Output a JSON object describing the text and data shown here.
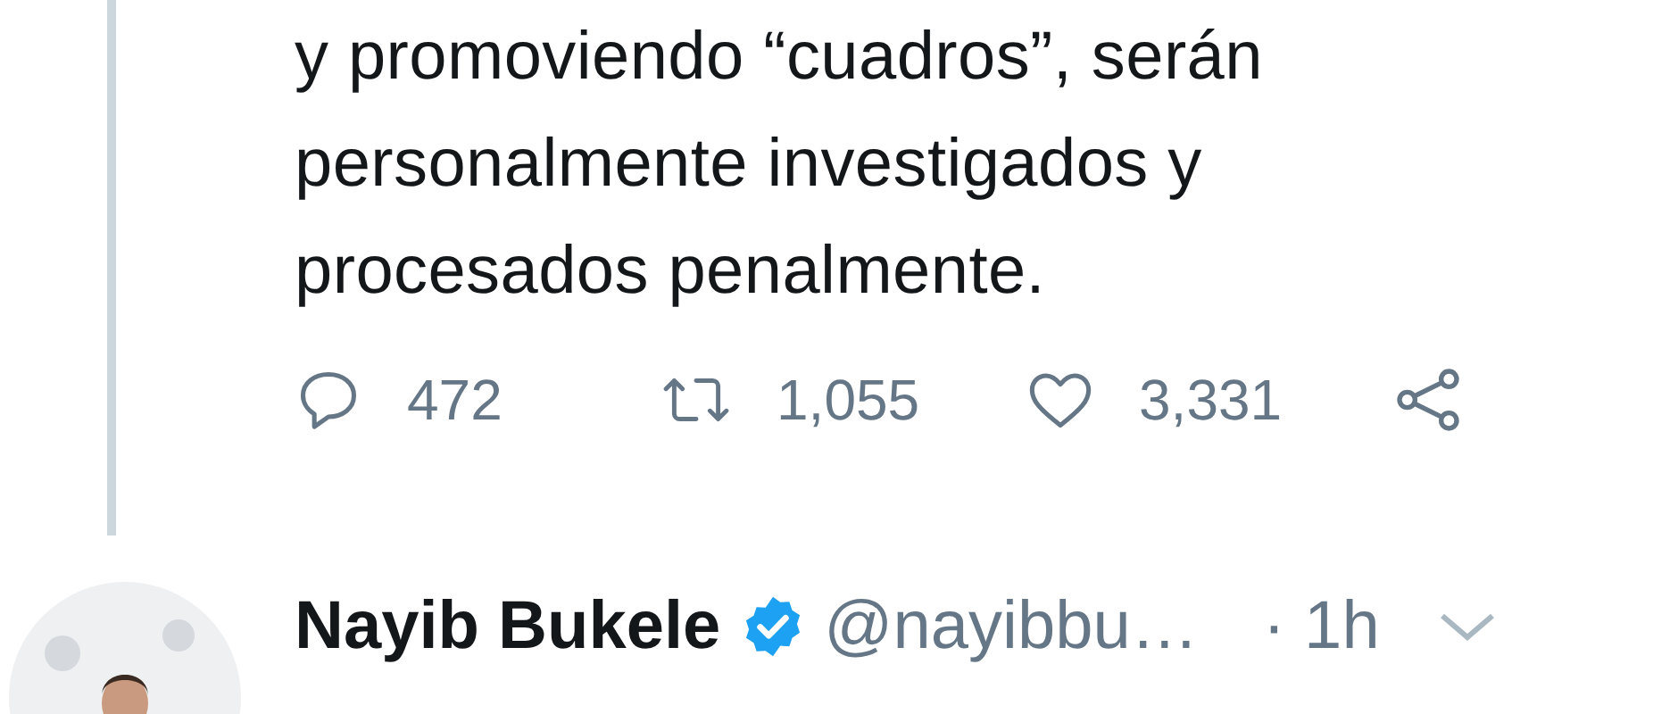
{
  "tweet": {
    "text_lines": [
      "y promoviendo “cuadros”, serán",
      "personalmente investigados y",
      "procesados penalmente."
    ],
    "actions": [
      {
        "kind": "reply",
        "count": "472"
      },
      {
        "kind": "retweet",
        "count": "1,055"
      },
      {
        "kind": "like",
        "count": "3,331"
      },
      {
        "kind": "share"
      }
    ]
  },
  "next_tweet": {
    "name": "Nayib Bukele",
    "verified": true,
    "handle": "@nayibbu…",
    "time": "· 1h"
  }
}
